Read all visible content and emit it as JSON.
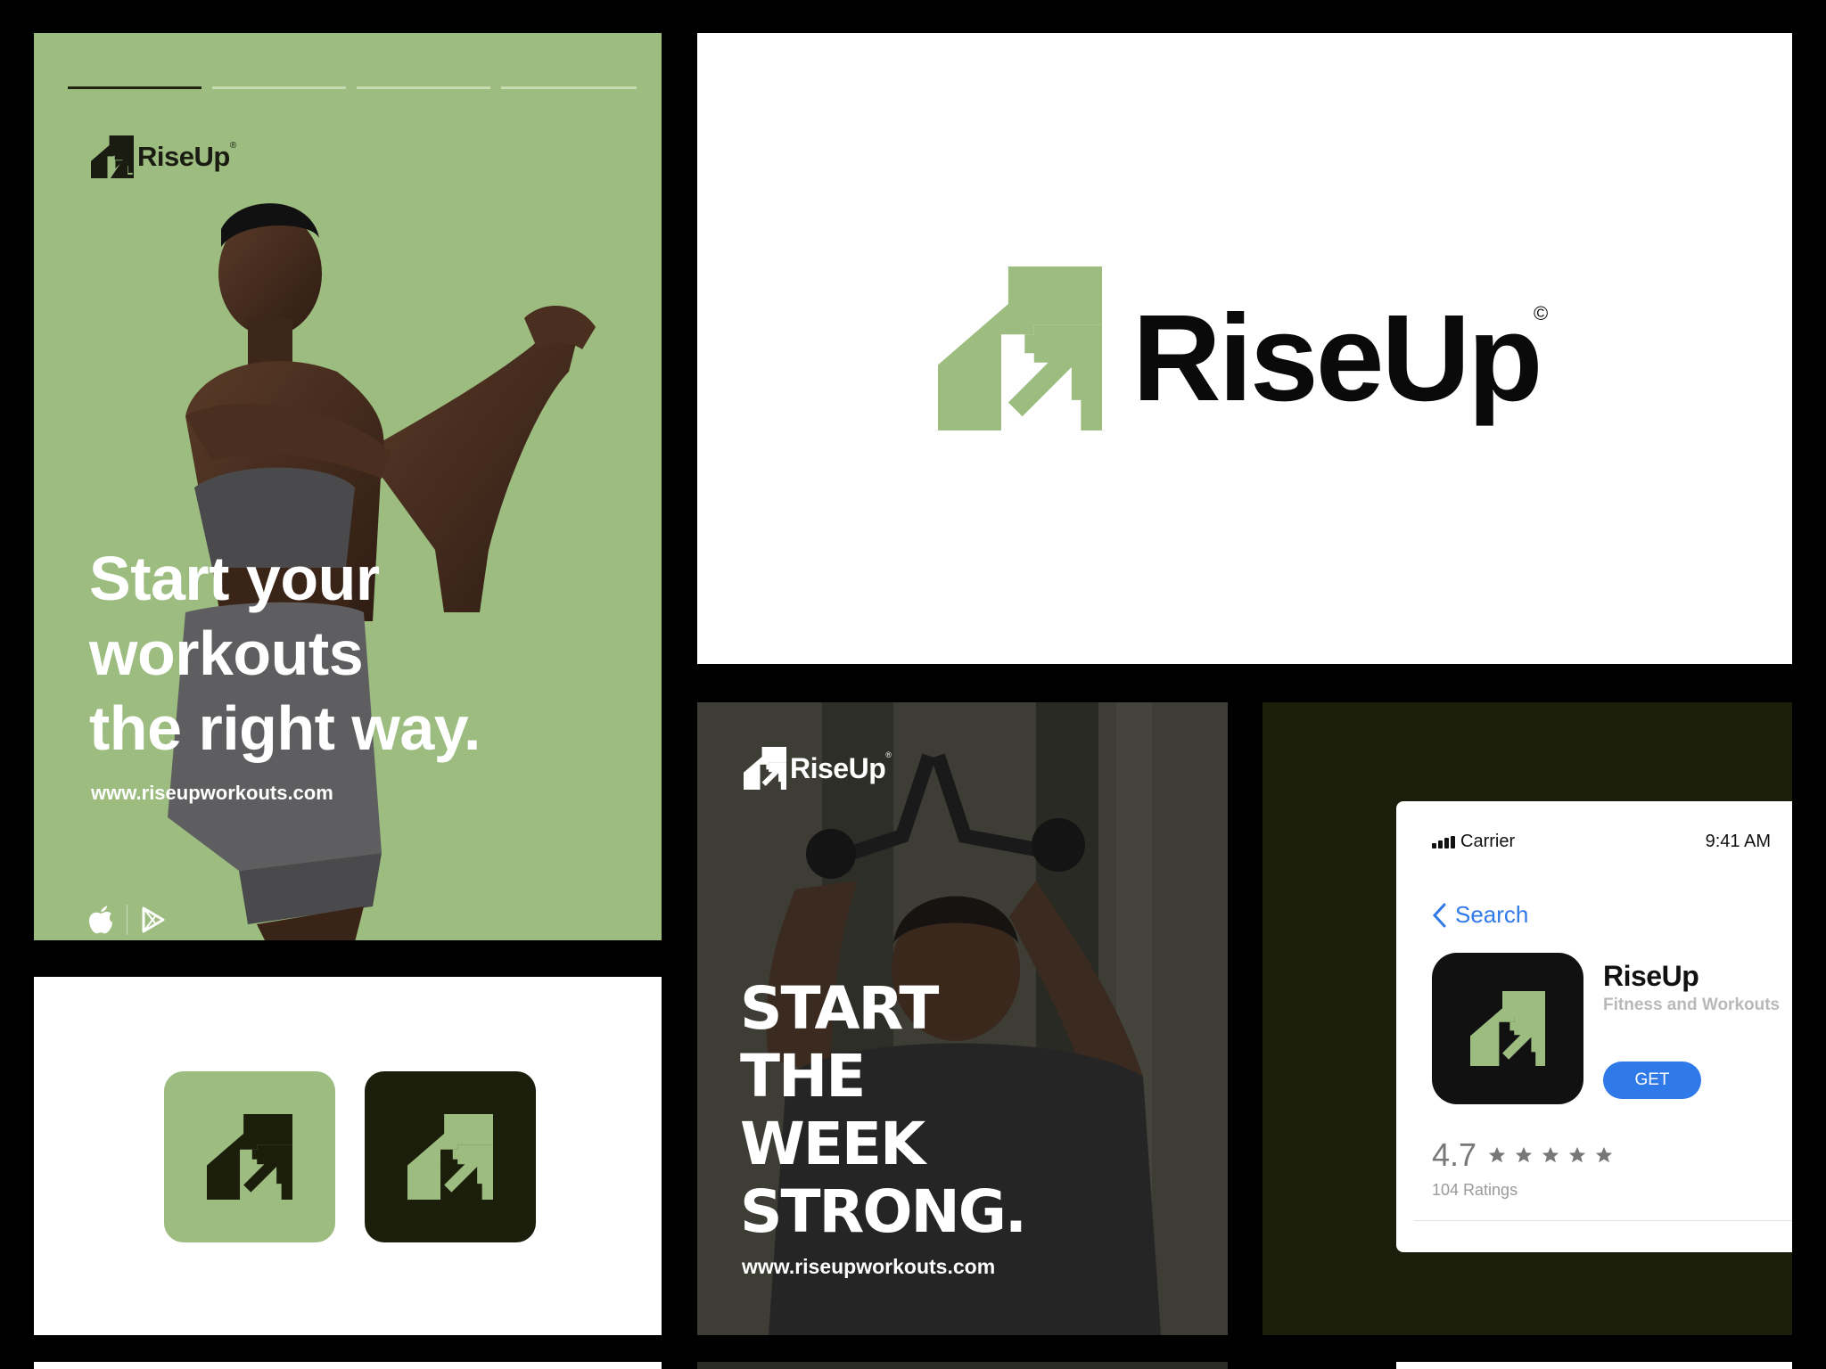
{
  "brand": {
    "name": "RiseUp",
    "registered_mark": "®",
    "copyright_mark": "©",
    "colors": {
      "green": "#9dbc80",
      "dark": "#1a1e0b",
      "black": "#000000",
      "white": "#ffffff"
    }
  },
  "poster1": {
    "headline": [
      "Start your",
      "workouts",
      "the right way."
    ],
    "url": "www.riseupworkouts.com",
    "progress_bars": 4,
    "store_icons": [
      "apple-icon",
      "google-play-icon"
    ]
  },
  "poster2": {
    "headline": [
      "START",
      "THE",
      "WEEK",
      "STRONG."
    ],
    "url": "www.riseupworkouts.com"
  },
  "app_icons": [
    "green-app-icon",
    "dark-app-icon"
  ],
  "app_store": {
    "carrier": "Carrier",
    "time": "9:41 AM",
    "back_label": "Search",
    "app_name": "RiseUp",
    "app_subtitle": "Fitness and Workouts",
    "get_label": "GET",
    "rating": "4.7",
    "stars": 5,
    "ratings_count": "104 Ratings"
  }
}
